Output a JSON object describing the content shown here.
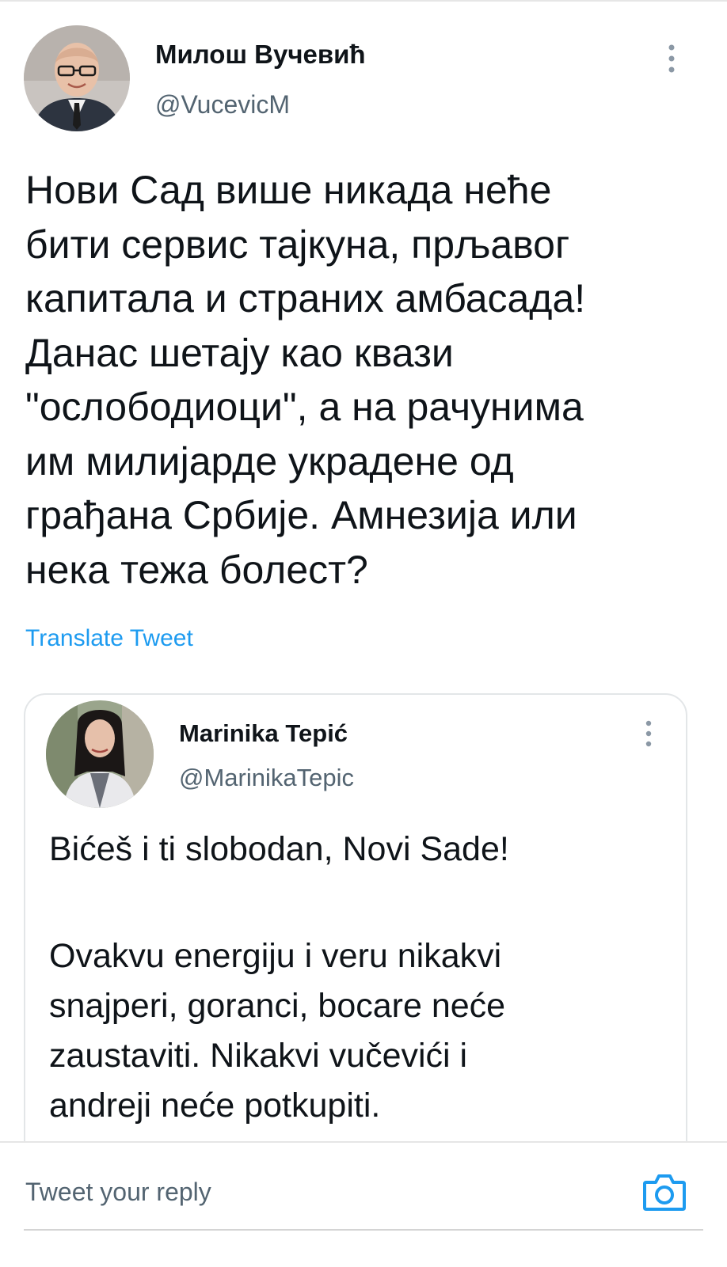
{
  "tweet": {
    "author_name": "Милош Вучевић",
    "author_handle": "@VucevicM",
    "text_lines": [
      "Нови Сад више никада неће",
      "бити сервис тајкуна, прљавог",
      "капитала и страних амбасада!",
      "Данас шетају као квази",
      "\"ослободиоци\", а на рачунима",
      "им милијарде украдене од",
      "грађана Србије. Амнезија или",
      "нека тежа болест?"
    ],
    "translate_label": "Translate Tweet"
  },
  "quoted_tweet": {
    "author_name": "Marinika Tepić",
    "author_handle": "@MarinikaTepic",
    "text_lines": [
      "Bićeš i ti slobodan, Novi Sade!",
      "",
      "Ovakvu energiju i veru nikakvi",
      "snajperi, goranci, bocare neće",
      "zaustaviti. Nikakvi vučevići i",
      "andreji neće potkupiti."
    ]
  },
  "reply": {
    "placeholder": "Tweet your reply"
  },
  "icons": {
    "more": "more-vertical-icon",
    "camera": "camera-icon"
  },
  "colors": {
    "link": "#1d9bf0",
    "secondary_text": "#536471",
    "primary_text": "#0f1419"
  }
}
